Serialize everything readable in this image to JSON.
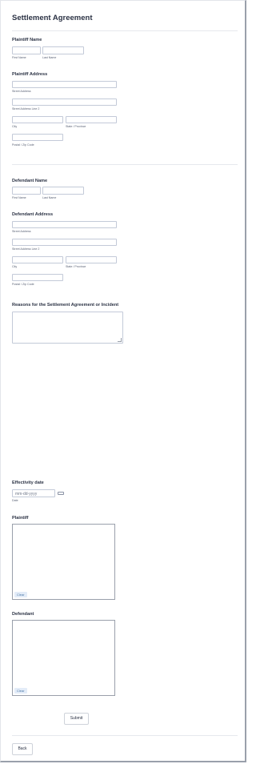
{
  "form": {
    "title": "Settlement Agreement",
    "plaintiff_name": {
      "label": "Plaintiff Name",
      "first_sublabel": "First Name",
      "last_sublabel": "Last Name"
    },
    "plaintiff_address": {
      "label": "Plaintiff Address",
      "street_sublabel": "Street Address",
      "street2_sublabel": "Street Address Line 2",
      "city_sublabel": "City",
      "state_sublabel": "State / Province",
      "zip_sublabel": "Postal / Zip Code"
    },
    "defendant_name": {
      "label": "Defendant Name",
      "first_sublabel": "First Name",
      "last_sublabel": "Last Name"
    },
    "defendant_address": {
      "label": "Defendant Address",
      "street_sublabel": "Street Address",
      "street2_sublabel": "Street Address Line 2",
      "city_sublabel": "City",
      "state_sublabel": "State / Province",
      "zip_sublabel": "Postal / Zip Code"
    },
    "reasons": {
      "label": "Reasons for the Settlement Agreement or Incident"
    },
    "effectivity": {
      "label": "Effectivity date",
      "placeholder": "mm-dd-yyyy",
      "sublabel": "Date",
      "icon": "calendar-icon"
    },
    "plaintiff_signature": {
      "label": "Plaintiff",
      "clear_label": "Clear"
    },
    "defendant_signature": {
      "label": "Defendant",
      "clear_label": "Clear"
    },
    "submit_label": "Submit",
    "back_label": "Back"
  }
}
